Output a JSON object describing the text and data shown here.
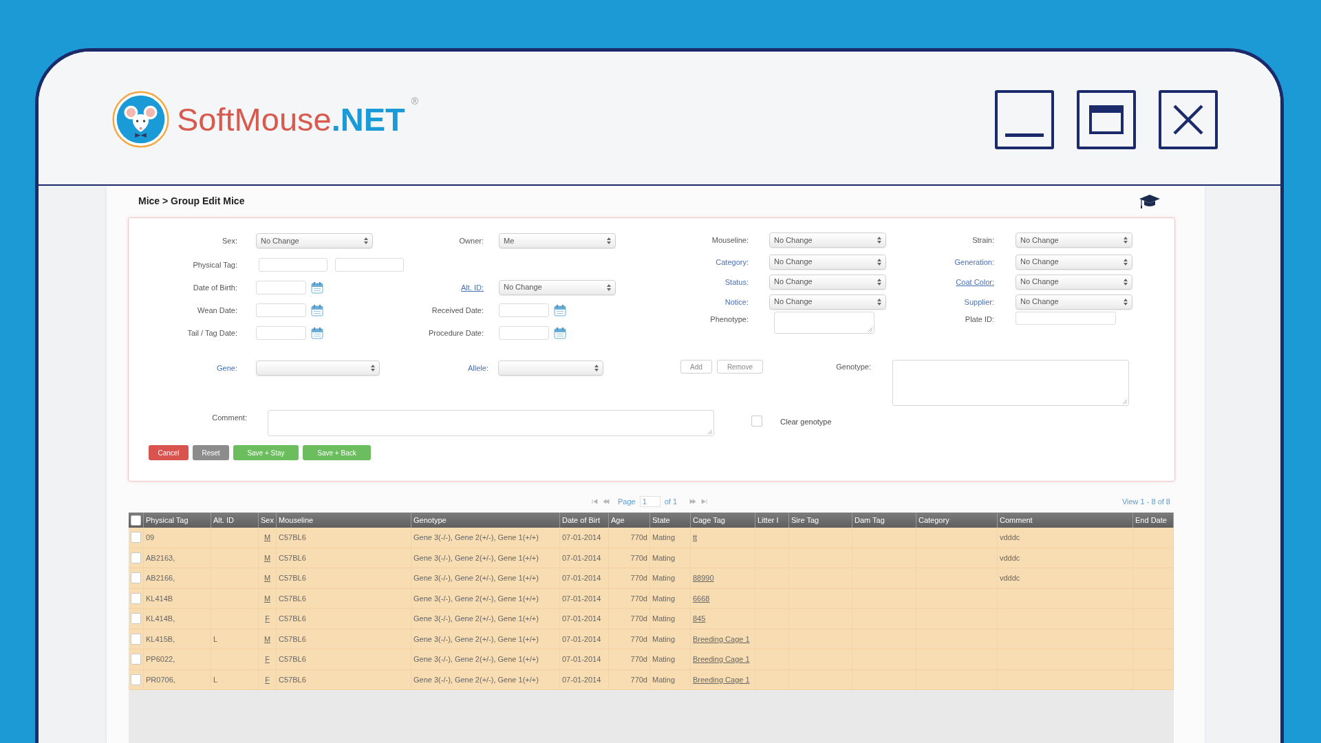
{
  "window": {
    "logo": {
      "name": "SoftMouse",
      "suffix": ".NET",
      "mark": "®"
    },
    "controls": [
      {
        "kind": "minimize"
      },
      {
        "kind": "maximize"
      },
      {
        "kind": "close"
      }
    ]
  },
  "breadcrumb": "Mice > Group Edit Mice",
  "form": {
    "left_rows": [
      [
        {
          "label": "Sex:",
          "link": false,
          "underlined": false,
          "control": {
            "kind": "select",
            "value": "No Change"
          }
        },
        {
          "label": "Owner:",
          "link": false,
          "underlined": false,
          "control": {
            "kind": "select",
            "value": "Me"
          }
        }
      ],
      [
        {
          "label": "Physical Tag:",
          "link": false,
          "underlined": false,
          "control": {
            "kind": "text_pair"
          }
        }
      ],
      [
        {
          "label": "Date of Birth:",
          "link": false,
          "underlined": false,
          "control": {
            "kind": "date"
          }
        },
        {
          "label": "Alt. ID:",
          "link": true,
          "underlined": true,
          "control": {
            "kind": "select",
            "value": "No Change"
          }
        }
      ],
      [
        {
          "label": "Wean Date:",
          "link": false,
          "underlined": false,
          "control": {
            "kind": "date"
          }
        },
        {
          "label": "Received Date:",
          "link": false,
          "underlined": false,
          "control": {
            "kind": "date"
          }
        }
      ],
      [
        {
          "label": "Tail / Tag Date:",
          "link": false,
          "underlined": false,
          "control": {
            "kind": "date"
          }
        },
        {
          "label": "Procedure Date:",
          "link": false,
          "underlined": false,
          "control": {
            "kind": "date"
          }
        }
      ]
    ],
    "right_rows": [
      [
        {
          "label": "Mouseline:",
          "link": false,
          "underlined": false,
          "control": {
            "kind": "select",
            "value": "No Change"
          }
        },
        {
          "label": "Strain:",
          "link": false,
          "underlined": false,
          "control": {
            "kind": "select",
            "value": "No Change"
          }
        }
      ],
      [
        {
          "label": "Category:",
          "link": true,
          "underlined": false,
          "control": {
            "kind": "select",
            "value": "No Change"
          }
        },
        {
          "label": "Generation:",
          "link": true,
          "underlined": false,
          "control": {
            "kind": "select",
            "value": "No Change"
          }
        }
      ],
      [
        {
          "label": "Status:",
          "link": true,
          "underlined": false,
          "control": {
            "kind": "select",
            "value": "No Change"
          }
        },
        {
          "label": "Coat Color:",
          "link": true,
          "underlined": true,
          "control": {
            "kind": "select",
            "value": "No Change"
          }
        }
      ],
      [
        {
          "label": "Notice:",
          "link": true,
          "underlined": false,
          "control": {
            "kind": "select",
            "value": "No Change"
          }
        },
        {
          "label": "Supplier:",
          "link": true,
          "underlined": false,
          "control": {
            "kind": "select",
            "value": "No Change"
          }
        }
      ],
      [
        {
          "label": "Phenotype:",
          "link": false,
          "underlined": false,
          "control": {
            "kind": "textarea"
          }
        },
        {
          "label": "Plate ID:",
          "link": false,
          "underlined": false,
          "control": {
            "kind": "text"
          }
        }
      ]
    ],
    "gene": {
      "label": "Gene:",
      "link": true,
      "underlined": false
    },
    "allele": {
      "label": "Allele:",
      "link": true,
      "underlined": false
    },
    "gene_buttons": [
      "Add",
      "Remove"
    ],
    "genotype": {
      "label": "Genotype:",
      "link": false,
      "underlined": false
    },
    "comment": {
      "label": "Comment:",
      "link": false,
      "underlined": false
    },
    "clear_genotype": {
      "label": "Clear genotype",
      "checked": false
    },
    "actions": [
      {
        "label": "Cancel",
        "kind": "danger"
      },
      {
        "label": "Reset",
        "kind": "secondary"
      },
      {
        "label": "Save + Stay",
        "kind": "success"
      },
      {
        "label": "Save + Back",
        "kind": "success"
      }
    ]
  },
  "pager": {
    "page_label": "Page",
    "page_value": "1",
    "of_label": "of 1",
    "view": "View 1 - 8 of 8"
  },
  "table": {
    "header_checked": false,
    "columns": [
      "Physical Tag",
      "Alt. ID",
      "Sex",
      "Mouseline",
      "Genotype",
      "Date of Birt",
      "Age",
      "State",
      "Cage Tag",
      "Litter I",
      "Sire Tag",
      "Dam Tag",
      "Category",
      "Comment",
      "End Date"
    ],
    "rows": [
      {
        "checked": false,
        "physical_tag": "09",
        "sex": "M",
        "mouseline": "C57BL6",
        "genotype": "Gene 3(-/-), Gene 2(+/-), Gene 1(+/+)",
        "date_of_birth": "07-01-2014",
        "age": "770d",
        "state": "Mating",
        "cage_tag": "tt",
        "comment": "vdddc"
      },
      {
        "checked": false,
        "physical_tag": "AB2163,",
        "sex": "M",
        "mouseline": "C57BL6",
        "genotype": "Gene 3(-/-), Gene 2(+/-), Gene 1(+/+)",
        "date_of_birth": "07-01-2014",
        "age": "770d",
        "state": "Mating",
        "comment": "vdddc"
      },
      {
        "checked": false,
        "physical_tag": "AB2166,",
        "sex": "M",
        "mouseline": "C57BL6",
        "genotype": "Gene 3(-/-), Gene 2(+/-), Gene 1(+/+)",
        "date_of_birth": "07-01-2014",
        "age": "770d",
        "state": "Mating",
        "cage_tag": "88990",
        "comment": "vdddc"
      },
      {
        "checked": false,
        "physical_tag": "KL414B",
        "sex": "M",
        "mouseline": "C57BL6",
        "genotype": "Gene 3(-/-), Gene 2(+/-), Gene 1(+/+)",
        "date_of_birth": "07-01-2014",
        "age": "770d",
        "state": "Mating",
        "cage_tag": "6668"
      },
      {
        "checked": false,
        "physical_tag": "KL414B,",
        "sex": "F",
        "mouseline": "C57BL6",
        "genotype": "Gene 3(-/-), Gene 2(+/-), Gene 1(+/+)",
        "date_of_birth": "07-01-2014",
        "age": "770d",
        "state": "Mating",
        "cage_tag": "845"
      },
      {
        "checked": false,
        "physical_tag": "KL415B,",
        "alt_id": "L",
        "sex": "M",
        "mouseline": "C57BL6",
        "genotype": "Gene 3(-/-), Gene 2(+/-), Gene 1(+/+)",
        "date_of_birth": "07-01-2014",
        "age": "770d",
        "state": "Mating",
        "cage_tag": "Breeding Cage 1"
      },
      {
        "checked": false,
        "physical_tag": "PP6022,",
        "sex": "F",
        "mouseline": "C57BL6",
        "genotype": "Gene 3(-/-), Gene 2(+/-), Gene 1(+/+)",
        "date_of_birth": "07-01-2014",
        "age": "770d",
        "state": "Mating",
        "cage_tag": "Breeding Cage 1"
      },
      {
        "checked": false,
        "physical_tag": "PR0706,",
        "alt_id": "L",
        "sex": "F",
        "mouseline": "C57BL6",
        "genotype": "Gene 3(-/-), Gene 2(+/-), Gene 1(+/+)",
        "date_of_birth": "07-01-2014",
        "age": "770d",
        "state": "Mating",
        "cage_tag": "Breeding Cage 1"
      }
    ]
  }
}
